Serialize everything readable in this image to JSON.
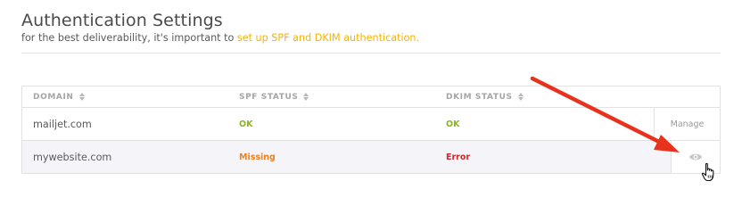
{
  "header": {
    "title": "Authentication Settings",
    "subtitle_prefix": "for the best deliverability, it's important to ",
    "subtitle_link": "set up SPF and DKIM authentication."
  },
  "table": {
    "columns": [
      "DOMAIN",
      "SPF STATUS",
      "DKIM STATUS"
    ],
    "rows": [
      {
        "domain": "mailjet.com",
        "spf": "OK",
        "dkim": "OK",
        "action": "Manage"
      },
      {
        "domain": "mywebsite.com",
        "spf": "Missing",
        "dkim": "Error",
        "action": "eye-icon"
      }
    ]
  },
  "colors": {
    "link": "#f4b400",
    "ok": "#8ab51e",
    "missing": "#f07f1e",
    "error": "#d8262a",
    "annotation_arrow": "#e8321e"
  }
}
